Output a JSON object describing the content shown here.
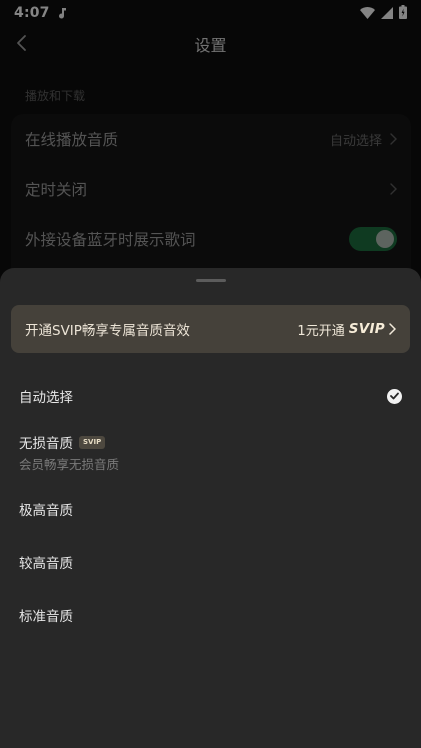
{
  "status_bar": {
    "time": "4:07"
  },
  "header": {
    "title": "设置"
  },
  "section": {
    "label": "播放和下载"
  },
  "settings": {
    "rows": [
      {
        "label": "在线播放音质",
        "value": "自动选择"
      },
      {
        "label": "定时关闭"
      },
      {
        "label": "外接设备蓝牙时展示歌词",
        "toggle_on": true
      }
    ]
  },
  "sheet": {
    "promo": {
      "text": "开通SVIP畅享专属音质音效",
      "price": "1元开通",
      "brand": "SVIP"
    },
    "options": [
      {
        "name": "自动选择",
        "selected": true
      },
      {
        "name": "无损音质",
        "badge": "SVIP",
        "subtitle": "会员畅享无损音质"
      },
      {
        "name": "极高音质"
      },
      {
        "name": "较高音质"
      },
      {
        "name": "标准音质"
      }
    ]
  },
  "colors": {
    "toggle_on": "#1c6b3c",
    "sheet_bg": "#282828",
    "promo_bg": "#45413a"
  }
}
